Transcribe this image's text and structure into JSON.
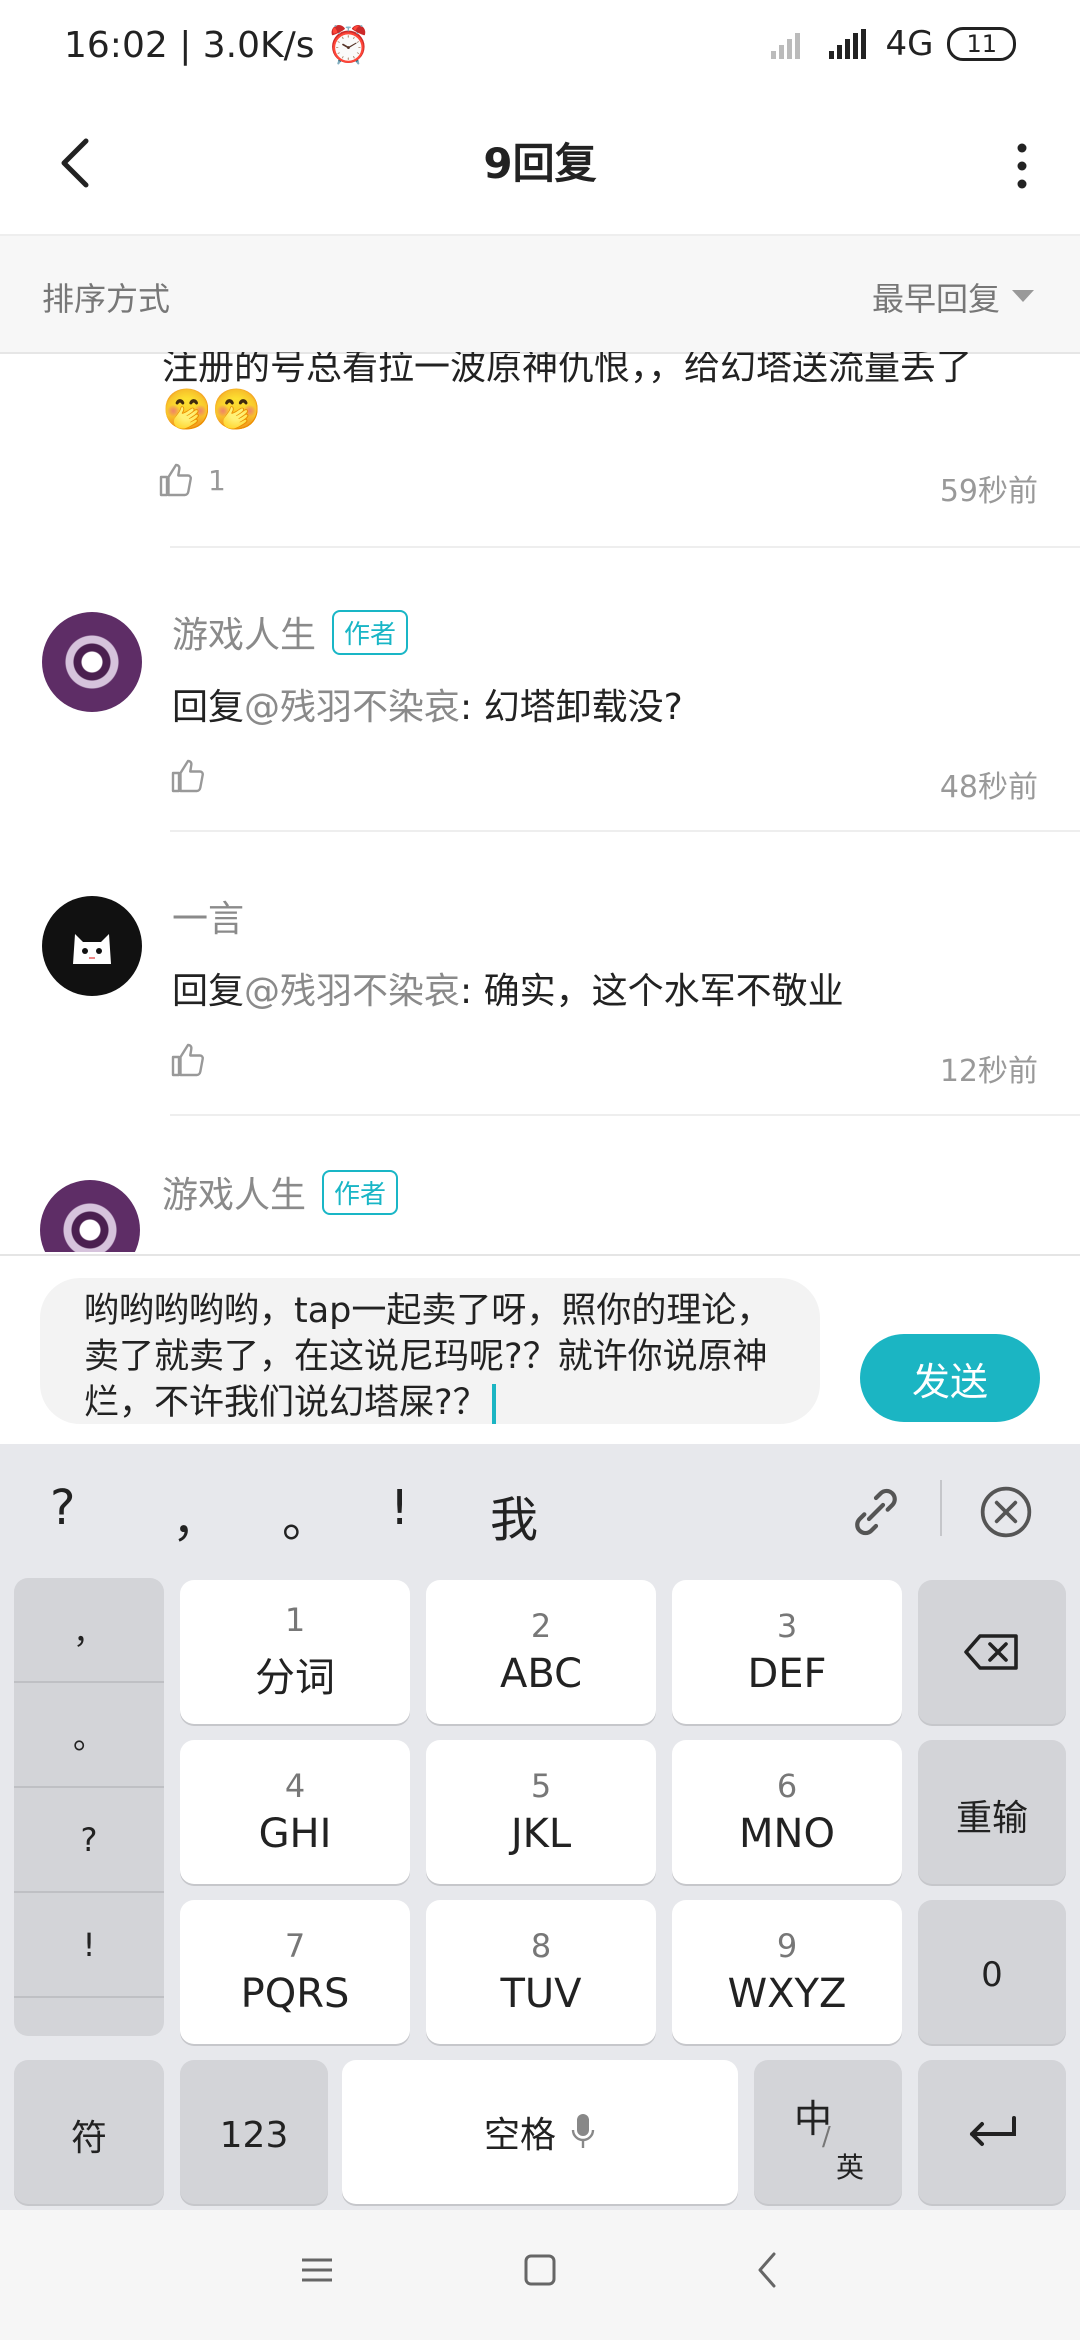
{
  "status_bar": {
    "time": "16:02",
    "speed": "3.0K/s",
    "network": "4G",
    "battery": "11"
  },
  "header": {
    "title": "9回复"
  },
  "sort": {
    "label": "排序方式",
    "value": "最早回复"
  },
  "comments": [
    {
      "partial_text": "注册的号总看拉一波原神仇恨，，给幻塔送流量丢了",
      "emoji": "🤭🤭",
      "likes": "1",
      "time": "59秒前"
    },
    {
      "name": "游戏人生",
      "badge": "作者",
      "reply_prefix": "回复",
      "mention": "@残羽不染哀",
      "text": ": 幻塔卸载没?",
      "time": "48秒前"
    },
    {
      "name": "一言",
      "reply_prefix": "回复",
      "mention": "@残羽不染哀",
      "text": ": 确实，这个水军不敬业",
      "time": "12秒前"
    },
    {
      "name": "游戏人生",
      "badge": "作者"
    }
  ],
  "input": {
    "value": "哟哟哟哟哟，tap一起卖了呀，照你的理论，卖了就卖了，在这说尼玛呢?？就许你说原神烂，不许我们说幻塔屎?？",
    "send_label": "发送"
  },
  "keyboard": {
    "candidates": [
      "?",
      "，",
      "。",
      "!",
      "我"
    ],
    "punct": [
      "，",
      "。",
      "?",
      "!"
    ],
    "keys": [
      {
        "num": "1",
        "letters": "分词"
      },
      {
        "num": "2",
        "letters": "ABC"
      },
      {
        "num": "3",
        "letters": "DEF"
      },
      {
        "num": "4",
        "letters": "GHI"
      },
      {
        "num": "5",
        "letters": "JKL"
      },
      {
        "num": "6",
        "letters": "MNO"
      },
      {
        "num": "7",
        "letters": "PQRS"
      },
      {
        "num": "8",
        "letters": "TUV"
      },
      {
        "num": "9",
        "letters": "WXYZ"
      }
    ],
    "reenter": "重输",
    "zero": "0",
    "symbols": "符",
    "num_mode": "123",
    "space": "空格",
    "lang_cn": "中",
    "lang_en": "英"
  },
  "colors": {
    "accent": "#1bb5c3",
    "text": "#222222",
    "muted": "#8a8a8a"
  }
}
